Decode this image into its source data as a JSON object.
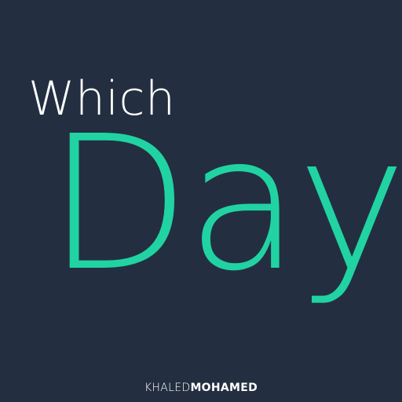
{
  "title": {
    "line1": "Which",
    "line2": "Day"
  },
  "author": {
    "first": "KHALED",
    "last": "MOHAMED"
  },
  "colors": {
    "background": "#232f40",
    "accent": "#21d3a3",
    "text": "#ffffff"
  }
}
